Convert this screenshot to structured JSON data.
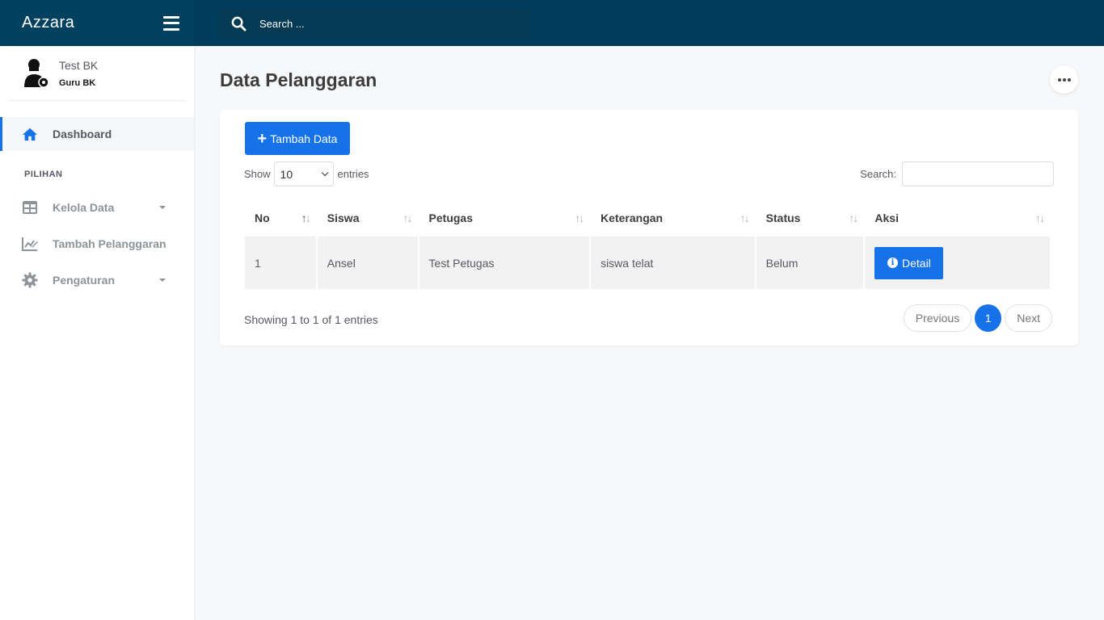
{
  "app": {
    "brand": "Azzara"
  },
  "header": {
    "search_placeholder": "Search ..."
  },
  "user": {
    "name": "Test BK",
    "role": "Guru BK"
  },
  "sidebar": {
    "section_title": "PILIHAN",
    "items": [
      {
        "label": "Dashboard",
        "icon": "home-icon",
        "active": true
      },
      {
        "label": "Kelola Data",
        "icon": "table-icon",
        "has_caret": true
      },
      {
        "label": "Tambah Pelanggaran",
        "icon": "chart-edit-icon"
      },
      {
        "label": "Pengaturan",
        "icon": "gear-icon",
        "has_caret": true
      }
    ]
  },
  "page": {
    "title": "Data Pelanggaran"
  },
  "toolbar": {
    "add_label": "Tambah Data",
    "show_label": "Show",
    "entries_value": "10",
    "entries_label": "entries",
    "search_label": "Search:"
  },
  "table": {
    "columns": [
      "No",
      "Siswa",
      "Petugas",
      "Keterangan",
      "Status",
      "Aksi"
    ],
    "rows": [
      {
        "no": "1",
        "siswa": "Ansel",
        "petugas": "Test Petugas",
        "keterangan": "siswa telat",
        "status": "Belum",
        "action": "Detail"
      }
    ]
  },
  "footer": {
    "info": "Showing 1 to 1 of 1 entries",
    "previous": "Previous",
    "page": "1",
    "next": "Next"
  },
  "colors": {
    "header_bg": "#02405f",
    "primary": "#1572e8"
  }
}
